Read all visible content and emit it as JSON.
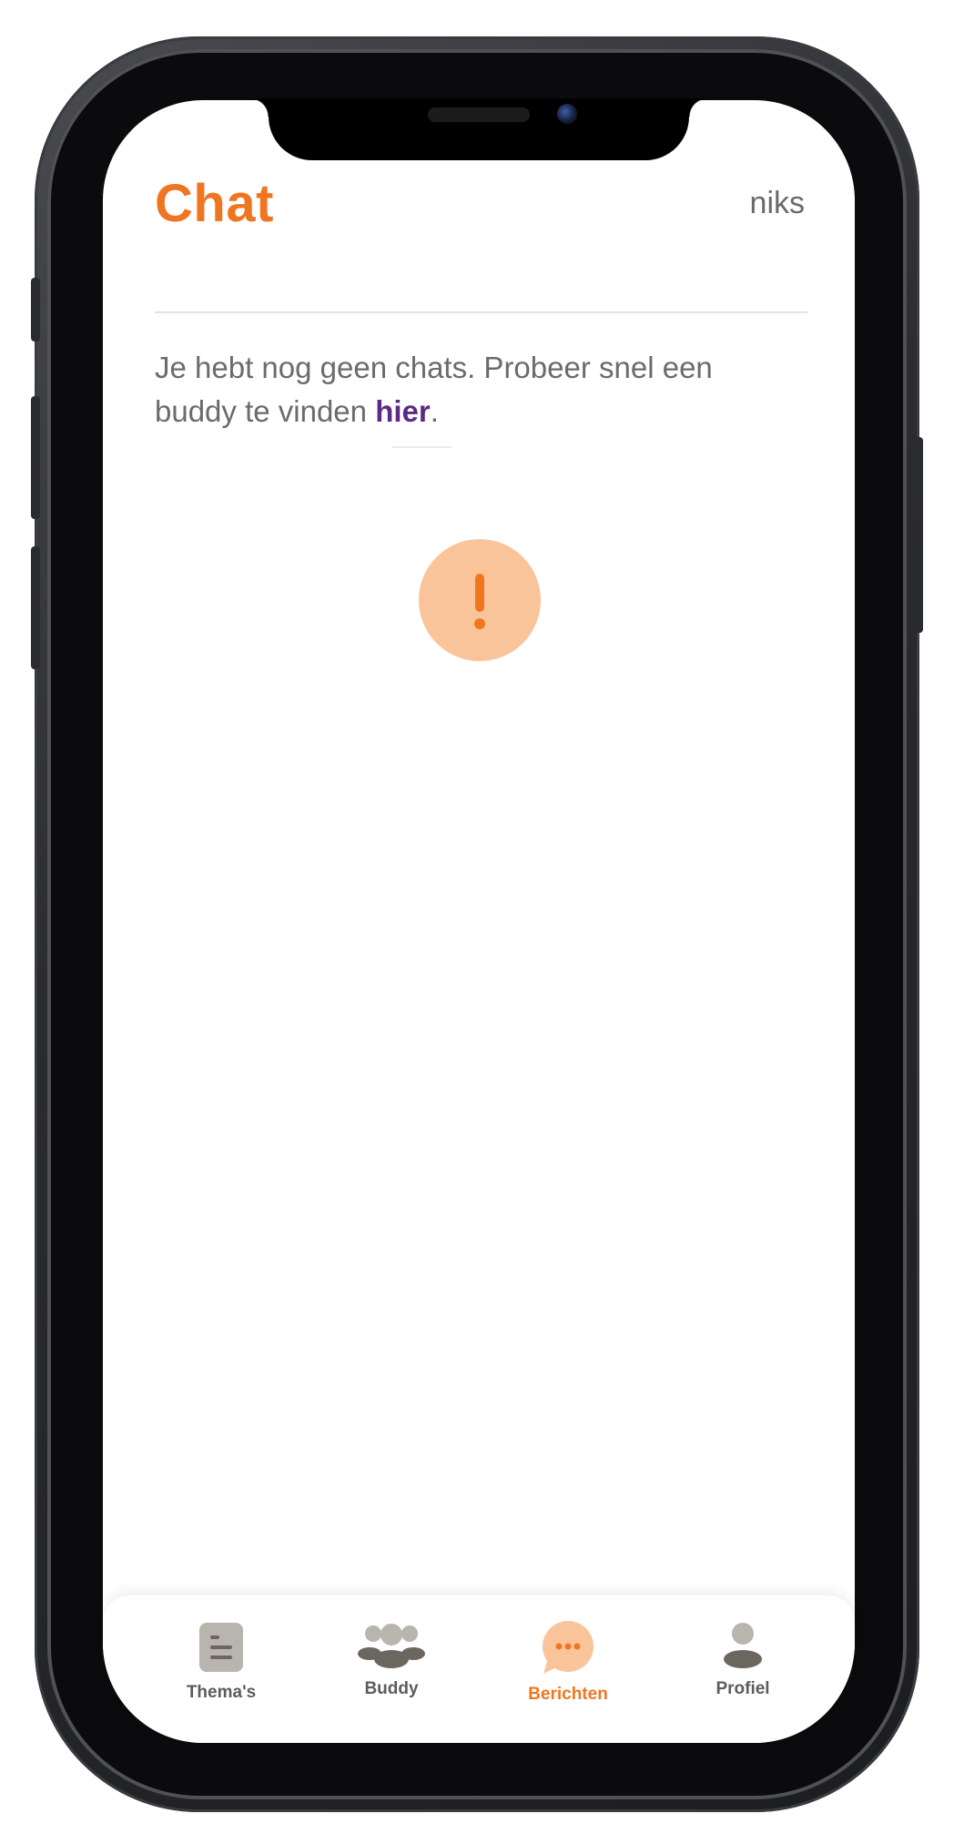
{
  "header": {
    "title": "Chat",
    "user_name": "niks"
  },
  "empty_state": {
    "message_part1": "Je hebt nog geen chats. Probeer snel een buddy te vinden ",
    "link_text": "hier",
    "message_part2": "."
  },
  "bottom_nav": {
    "items": [
      {
        "label": "Thema's",
        "icon": "document-icon",
        "active": false
      },
      {
        "label": "Buddy",
        "icon": "group-icon",
        "active": false
      },
      {
        "label": "Berichten",
        "icon": "chat-bubble-icon",
        "active": true
      },
      {
        "label": "Profiel",
        "icon": "person-icon",
        "active": false
      }
    ]
  },
  "colors": {
    "accent": "#f07521",
    "accent_light": "#f9c49a",
    "link": "#5b2a86",
    "text": "#6b6b6b"
  }
}
